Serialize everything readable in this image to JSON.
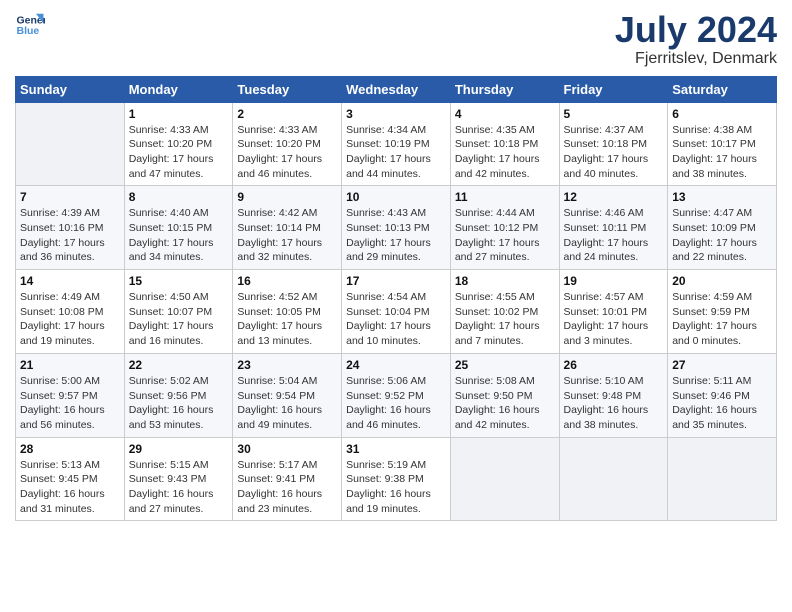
{
  "header": {
    "logo_line1": "General",
    "logo_line2": "Blue",
    "month_year": "July 2024",
    "location": "Fjerritslev, Denmark"
  },
  "days_of_week": [
    "Sunday",
    "Monday",
    "Tuesday",
    "Wednesday",
    "Thursday",
    "Friday",
    "Saturday"
  ],
  "weeks": [
    [
      {
        "num": "",
        "detail": ""
      },
      {
        "num": "1",
        "detail": "Sunrise: 4:33 AM\nSunset: 10:20 PM\nDaylight: 17 hours\nand 47 minutes."
      },
      {
        "num": "2",
        "detail": "Sunrise: 4:33 AM\nSunset: 10:20 PM\nDaylight: 17 hours\nand 46 minutes."
      },
      {
        "num": "3",
        "detail": "Sunrise: 4:34 AM\nSunset: 10:19 PM\nDaylight: 17 hours\nand 44 minutes."
      },
      {
        "num": "4",
        "detail": "Sunrise: 4:35 AM\nSunset: 10:18 PM\nDaylight: 17 hours\nand 42 minutes."
      },
      {
        "num": "5",
        "detail": "Sunrise: 4:37 AM\nSunset: 10:18 PM\nDaylight: 17 hours\nand 40 minutes."
      },
      {
        "num": "6",
        "detail": "Sunrise: 4:38 AM\nSunset: 10:17 PM\nDaylight: 17 hours\nand 38 minutes."
      }
    ],
    [
      {
        "num": "7",
        "detail": "Sunrise: 4:39 AM\nSunset: 10:16 PM\nDaylight: 17 hours\nand 36 minutes."
      },
      {
        "num": "8",
        "detail": "Sunrise: 4:40 AM\nSunset: 10:15 PM\nDaylight: 17 hours\nand 34 minutes."
      },
      {
        "num": "9",
        "detail": "Sunrise: 4:42 AM\nSunset: 10:14 PM\nDaylight: 17 hours\nand 32 minutes."
      },
      {
        "num": "10",
        "detail": "Sunrise: 4:43 AM\nSunset: 10:13 PM\nDaylight: 17 hours\nand 29 minutes."
      },
      {
        "num": "11",
        "detail": "Sunrise: 4:44 AM\nSunset: 10:12 PM\nDaylight: 17 hours\nand 27 minutes."
      },
      {
        "num": "12",
        "detail": "Sunrise: 4:46 AM\nSunset: 10:11 PM\nDaylight: 17 hours\nand 24 minutes."
      },
      {
        "num": "13",
        "detail": "Sunrise: 4:47 AM\nSunset: 10:09 PM\nDaylight: 17 hours\nand 22 minutes."
      }
    ],
    [
      {
        "num": "14",
        "detail": "Sunrise: 4:49 AM\nSunset: 10:08 PM\nDaylight: 17 hours\nand 19 minutes."
      },
      {
        "num": "15",
        "detail": "Sunrise: 4:50 AM\nSunset: 10:07 PM\nDaylight: 17 hours\nand 16 minutes."
      },
      {
        "num": "16",
        "detail": "Sunrise: 4:52 AM\nSunset: 10:05 PM\nDaylight: 17 hours\nand 13 minutes."
      },
      {
        "num": "17",
        "detail": "Sunrise: 4:54 AM\nSunset: 10:04 PM\nDaylight: 17 hours\nand 10 minutes."
      },
      {
        "num": "18",
        "detail": "Sunrise: 4:55 AM\nSunset: 10:02 PM\nDaylight: 17 hours\nand 7 minutes."
      },
      {
        "num": "19",
        "detail": "Sunrise: 4:57 AM\nSunset: 10:01 PM\nDaylight: 17 hours\nand 3 minutes."
      },
      {
        "num": "20",
        "detail": "Sunrise: 4:59 AM\nSunset: 9:59 PM\nDaylight: 17 hours\nand 0 minutes."
      }
    ],
    [
      {
        "num": "21",
        "detail": "Sunrise: 5:00 AM\nSunset: 9:57 PM\nDaylight: 16 hours\nand 56 minutes."
      },
      {
        "num": "22",
        "detail": "Sunrise: 5:02 AM\nSunset: 9:56 PM\nDaylight: 16 hours\nand 53 minutes."
      },
      {
        "num": "23",
        "detail": "Sunrise: 5:04 AM\nSunset: 9:54 PM\nDaylight: 16 hours\nand 49 minutes."
      },
      {
        "num": "24",
        "detail": "Sunrise: 5:06 AM\nSunset: 9:52 PM\nDaylight: 16 hours\nand 46 minutes."
      },
      {
        "num": "25",
        "detail": "Sunrise: 5:08 AM\nSunset: 9:50 PM\nDaylight: 16 hours\nand 42 minutes."
      },
      {
        "num": "26",
        "detail": "Sunrise: 5:10 AM\nSunset: 9:48 PM\nDaylight: 16 hours\nand 38 minutes."
      },
      {
        "num": "27",
        "detail": "Sunrise: 5:11 AM\nSunset: 9:46 PM\nDaylight: 16 hours\nand 35 minutes."
      }
    ],
    [
      {
        "num": "28",
        "detail": "Sunrise: 5:13 AM\nSunset: 9:45 PM\nDaylight: 16 hours\nand 31 minutes."
      },
      {
        "num": "29",
        "detail": "Sunrise: 5:15 AM\nSunset: 9:43 PM\nDaylight: 16 hours\nand 27 minutes."
      },
      {
        "num": "30",
        "detail": "Sunrise: 5:17 AM\nSunset: 9:41 PM\nDaylight: 16 hours\nand 23 minutes."
      },
      {
        "num": "31",
        "detail": "Sunrise: 5:19 AM\nSunset: 9:38 PM\nDaylight: 16 hours\nand 19 minutes."
      },
      {
        "num": "",
        "detail": ""
      },
      {
        "num": "",
        "detail": ""
      },
      {
        "num": "",
        "detail": ""
      }
    ]
  ]
}
